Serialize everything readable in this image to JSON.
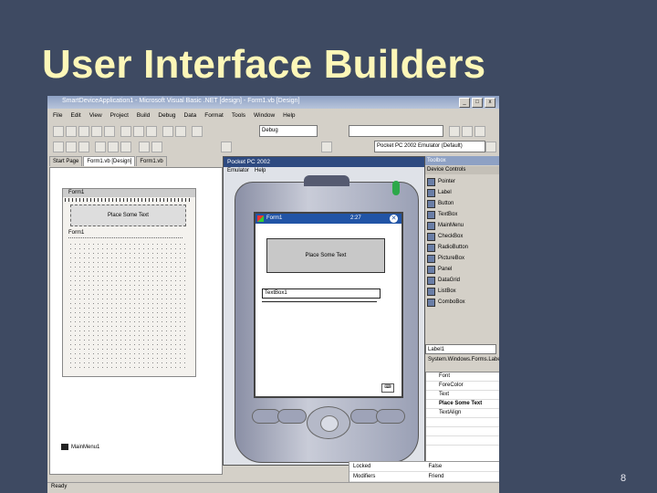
{
  "slide": {
    "title": "User Interface Builders",
    "page_number": "8"
  },
  "ide": {
    "window_title": "SmartDeviceApplication1 - Microsoft Visual Basic .NET [design] - Form1.vb [Design]",
    "menu": [
      "File",
      "Edit",
      "View",
      "Project",
      "Build",
      "Debug",
      "Data",
      "Format",
      "Tools",
      "Window",
      "Help"
    ],
    "config_combo": "Debug",
    "device_combo": "Pocket PC 2002 Emulator (Default)",
    "tabs": [
      "Start Page",
      "Form1.vb [Design]",
      "Form1.vb"
    ],
    "form": {
      "title": "Form1",
      "label_text": "Place Some Text",
      "field_text": "Form1"
    },
    "main_menu_component": "MainMenu1",
    "status": "Ready"
  },
  "emulator": {
    "title": "Pocket PC 2002",
    "menu": [
      "Emulator",
      "Help"
    ],
    "screen": {
      "app_title": "Form1",
      "time": "2:27",
      "close_glyph": "✕",
      "label_text": "Place Some Text",
      "input_text": "TextBox1"
    }
  },
  "toolbox": {
    "title": "Toolbox",
    "category": "Device Controls",
    "items": [
      "Pointer",
      "Label",
      "Button",
      "TextBox",
      "MainMenu",
      "CheckBox",
      "RadioButton",
      "PictureBox",
      "Panel",
      "DataGrid",
      "ListBox",
      "ComboBox"
    ]
  },
  "properties": {
    "object_combo": "Label1 System.Windows.Forms.Label",
    "rows": [
      "Font",
      "ForeColor",
      "Text",
      "Place Some Text",
      "TextAlign",
      "",
      "",
      "",
      "Locked",
      "Modifiers"
    ],
    "bottom_rows": [
      [
        "Locked",
        "False"
      ],
      [
        "Modifiers",
        "Friend"
      ]
    ]
  },
  "icons": {
    "windows-flag": "windows-flag-icon",
    "close": "close-icon",
    "keyboard": "keyboard-icon"
  },
  "colors": {
    "slide_bg": "#3e4a62",
    "title": "#fdf7b8",
    "pocketpc_titlebar": "#2154a6"
  }
}
